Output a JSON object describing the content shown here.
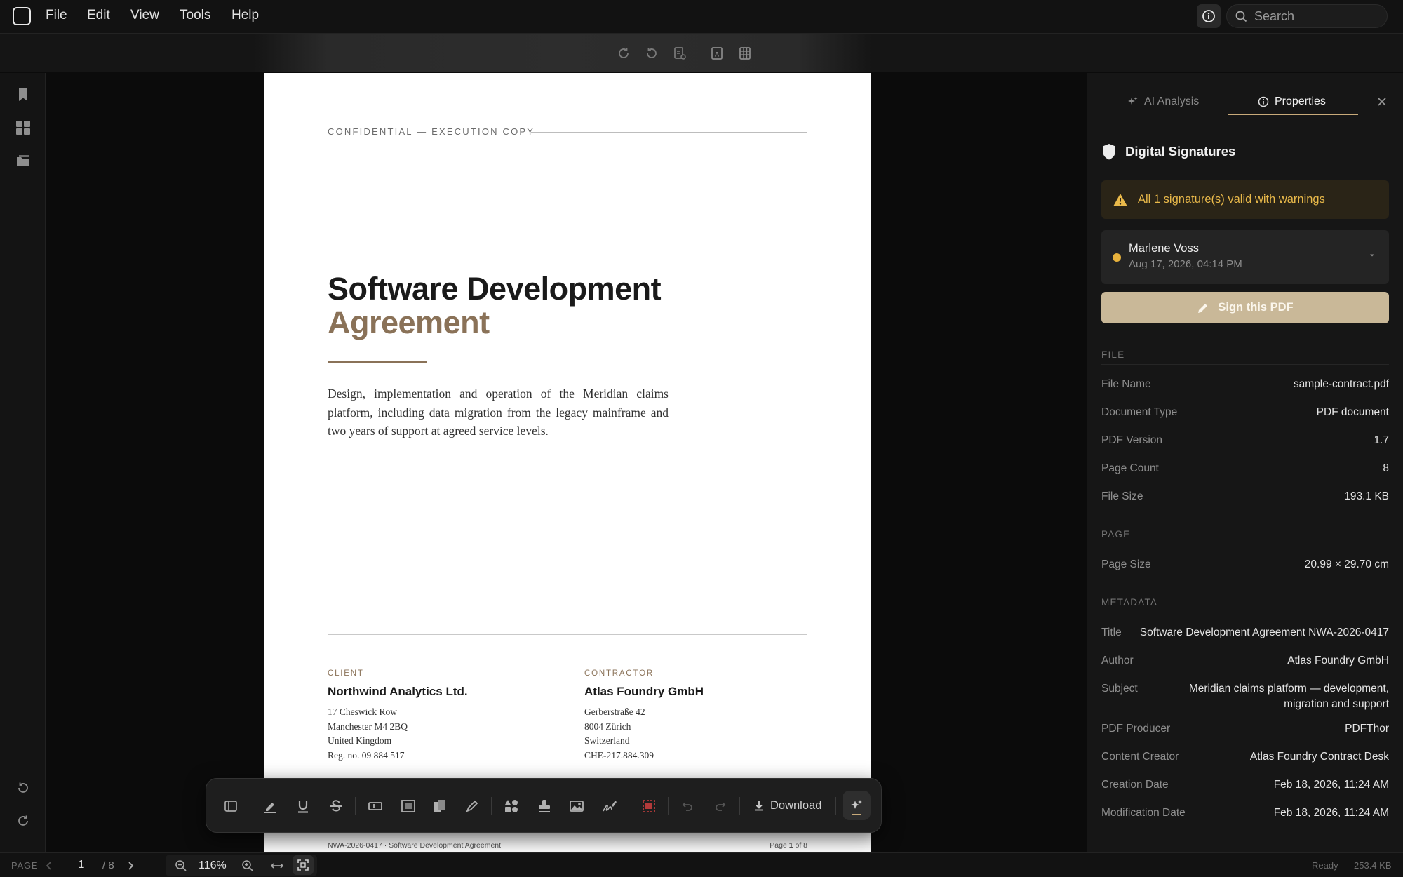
{
  "menu": {
    "items": [
      "File",
      "Edit",
      "View",
      "Tools",
      "Help"
    ]
  },
  "search": {
    "placeholder": "Search"
  },
  "document": {
    "header_label": "CONFIDENTIAL — EXECUTION COPY",
    "title_line1": "Software Development",
    "title_line2": "Agreement",
    "abstract": "Design, implementation and operation of the Meridian claims platform, including data migration from the legacy mainframe and two years of support at agreed service levels.",
    "client": {
      "label": "CLIENT",
      "name": "Northwind Analytics Ltd.",
      "address": [
        "17 Cheswick Row",
        "Manchester M4 2BQ",
        "United Kingdom",
        "Reg. no. 09 884 517"
      ]
    },
    "contractor": {
      "label": "CONTRACTOR",
      "name": "Atlas Foundry GmbH",
      "address": [
        "Gerberstraße 42",
        "8004 Zürich",
        "Switzerland",
        "CHE-217.884.309"
      ]
    },
    "footer_left": "NWA-2026-0417 · Software Development Agreement",
    "footer_page_prefix": "Page",
    "footer_page_current": "1",
    "footer_page_suffix": "of 8"
  },
  "annotation_toolbar": {
    "download_label": "Download"
  },
  "statusbar": {
    "page_label": "PAGE",
    "page_current": "1",
    "page_total": "/ 8",
    "zoom": "116%",
    "status": "Ready",
    "memory": "253.4 KB"
  },
  "panel": {
    "tabs": {
      "ai": "AI Analysis",
      "properties": "Properties"
    },
    "signatures": {
      "heading": "Digital Signatures",
      "warning": "All 1 signature(s) valid with warnings",
      "signer_name": "Marlene Voss",
      "signer_date": "Aug 17, 2026, 04:14 PM",
      "sign_button": "Sign this PDF"
    },
    "file_section": "FILE",
    "file": [
      {
        "k": "File Name",
        "v": "sample-contract.pdf"
      },
      {
        "k": "Document Type",
        "v": "PDF document"
      },
      {
        "k": "PDF Version",
        "v": "1.7"
      },
      {
        "k": "Page Count",
        "v": "8"
      },
      {
        "k": "File Size",
        "v": "193.1 KB"
      }
    ],
    "page_section": "PAGE",
    "page": [
      {
        "k": "Page Size",
        "v": "20.99 × 29.70 cm"
      }
    ],
    "metadata_section": "METADATA",
    "metadata": [
      {
        "k": "Title",
        "v": "Software Development Agreement NWA-2026-0417"
      },
      {
        "k": "Author",
        "v": "Atlas Foundry GmbH"
      },
      {
        "k": "Subject",
        "v": "Meridian claims platform — development, migration and support"
      },
      {
        "k": "PDF Producer",
        "v": "PDFThor"
      },
      {
        "k": "Content Creator",
        "v": "Atlas Foundry Contract Desk"
      },
      {
        "k": "Creation Date",
        "v": "Feb 18, 2026, 11:24 AM"
      },
      {
        "k": "Modification Date",
        "v": "Feb 18, 2026, 11:24 AM"
      }
    ]
  },
  "colors": {
    "accent": "#c8aa7a",
    "warning": "#e9b94a",
    "title_accent": "#8a7258"
  }
}
